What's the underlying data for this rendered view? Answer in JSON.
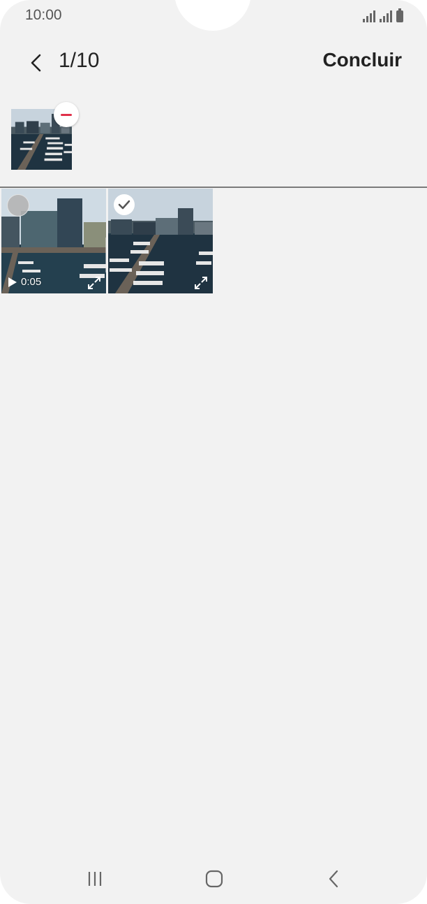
{
  "status_bar": {
    "time": "10:00",
    "icons": [
      "signal-icon",
      "signal-icon",
      "battery-icon"
    ]
  },
  "header": {
    "back_icon": "chevron-left-icon",
    "counter": "1/10",
    "done_label": "Concluir"
  },
  "selected": {
    "items": [
      {
        "type": "image",
        "remove_icon": "minus-icon",
        "remove_color": "#e0304a"
      }
    ]
  },
  "gallery": {
    "items": [
      {
        "type": "video",
        "duration": "0:05",
        "selected": false,
        "icons": [
          "play-icon",
          "expand-icon"
        ]
      },
      {
        "type": "image",
        "selected": true,
        "icons": [
          "checkmark-icon",
          "expand-icon"
        ]
      }
    ]
  },
  "nav_bar": {
    "icons": [
      "recent-apps-icon",
      "home-icon",
      "back-icon"
    ]
  },
  "colors": {
    "background": "#f2f2f2",
    "divider": "#7a7a7a",
    "remove_accent": "#e0304a"
  }
}
